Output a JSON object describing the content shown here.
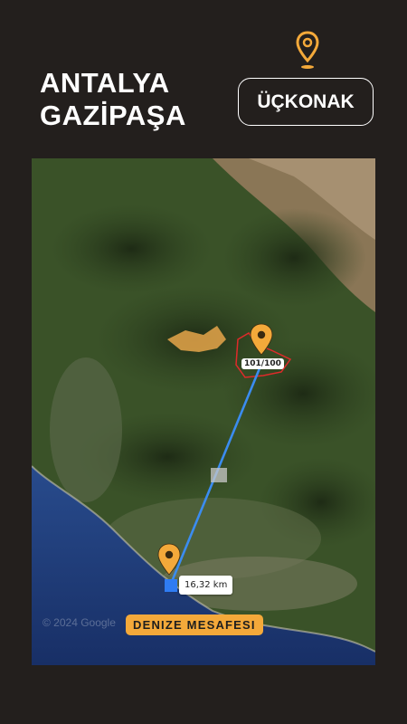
{
  "header": {
    "title_line1": "ANTALYA",
    "title_line2": "GAZİPAŞA",
    "location_badge": "ÜÇKONAK"
  },
  "map": {
    "parcel_label": "101/100",
    "distance_label": "16,32 km",
    "sea_distance_caption": "DENIZE MESAFESI",
    "watermark": "© 2024 Google"
  },
  "colors": {
    "background": "#231f1d",
    "accent": "#f4a93a",
    "route_line": "#3b8cf0",
    "parcel_outline": "#e02a2a",
    "sea": "#1f3a78"
  },
  "icons": {
    "top_pin": "map-pin-icon",
    "parcel_pin": "map-pin-icon",
    "coast_pin": "map-pin-icon"
  }
}
